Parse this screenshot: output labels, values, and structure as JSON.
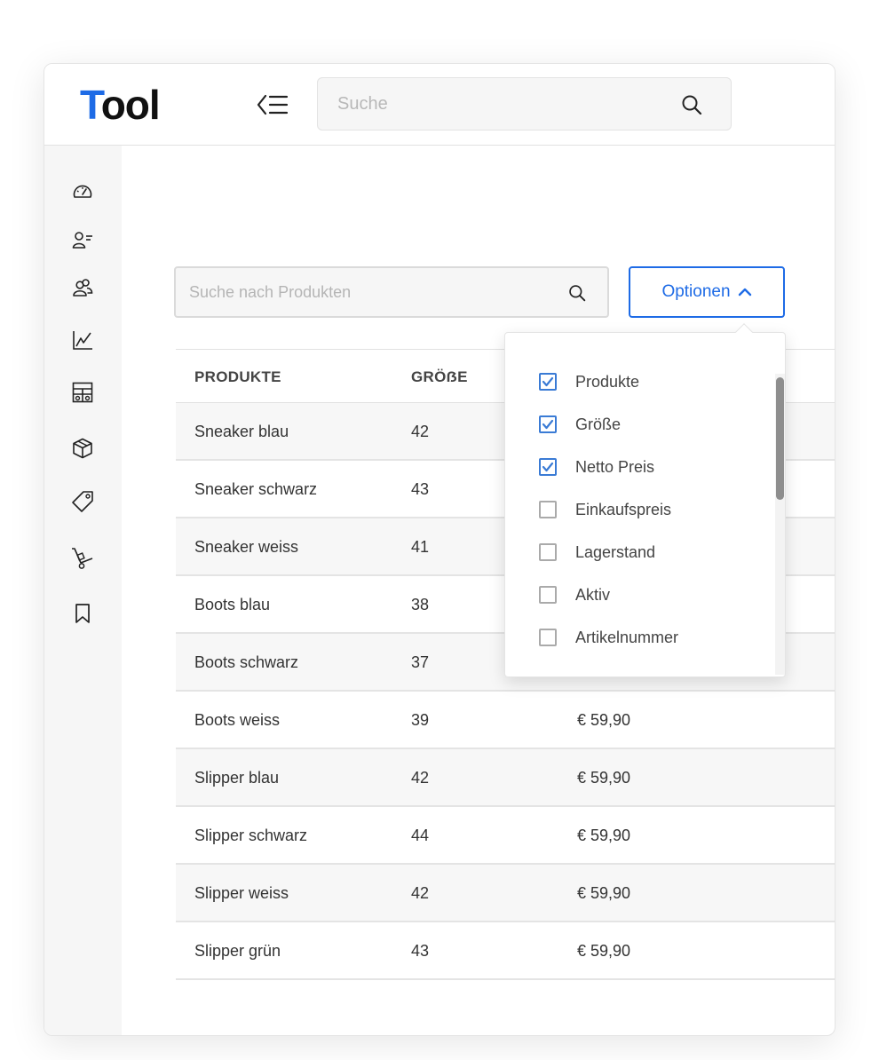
{
  "header": {
    "logo_first": "T",
    "logo_rest": "ool",
    "search_placeholder": "Suche"
  },
  "sidebar": {
    "items": [
      {
        "icon": "dashboard-icon"
      },
      {
        "icon": "user-list-icon"
      },
      {
        "icon": "users-icon"
      },
      {
        "icon": "chart-icon"
      },
      {
        "icon": "layout-icon"
      },
      {
        "icon": "box-icon"
      },
      {
        "icon": "tag-icon"
      },
      {
        "icon": "hand-truck-icon"
      },
      {
        "icon": "bookmark-icon"
      }
    ]
  },
  "products": {
    "search_placeholder": "Suche nach Produkten",
    "options_label": "Optionen",
    "columns": [
      "PRODUKTE",
      "GRÖẞE"
    ],
    "rows": [
      {
        "name": "Sneaker blau",
        "size": "42",
        "price": ""
      },
      {
        "name": "Sneaker schwarz",
        "size": "43",
        "price": ""
      },
      {
        "name": "Sneaker weiss",
        "size": "41",
        "price": ""
      },
      {
        "name": "Boots blau",
        "size": "38",
        "price": ""
      },
      {
        "name": "Boots schwarz",
        "size": "37",
        "price": ""
      },
      {
        "name": "Boots weiss",
        "size": "39",
        "price": "€ 59,90"
      },
      {
        "name": "Slipper blau",
        "size": "42",
        "price": "€ 59,90"
      },
      {
        "name": "Slipper schwarz",
        "size": "44",
        "price": "€ 59,90"
      },
      {
        "name": "Slipper weiss",
        "size": "42",
        "price": "€ 59,90"
      },
      {
        "name": "Slipper grün",
        "size": "43",
        "price": "€ 59,90"
      }
    ]
  },
  "options_menu": {
    "items": [
      {
        "label": "Produkte",
        "checked": true
      },
      {
        "label": "Größe",
        "checked": true
      },
      {
        "label": "Netto Preis",
        "checked": true
      },
      {
        "label": "Einkaufspreis",
        "checked": false
      },
      {
        "label": "Lagerstand",
        "checked": false
      },
      {
        "label": "Aktiv",
        "checked": false
      },
      {
        "label": "Artikelnummer",
        "checked": false
      }
    ]
  },
  "colors": {
    "accent": "#1e6be6",
    "checkbox": "#3a7bd5"
  }
}
